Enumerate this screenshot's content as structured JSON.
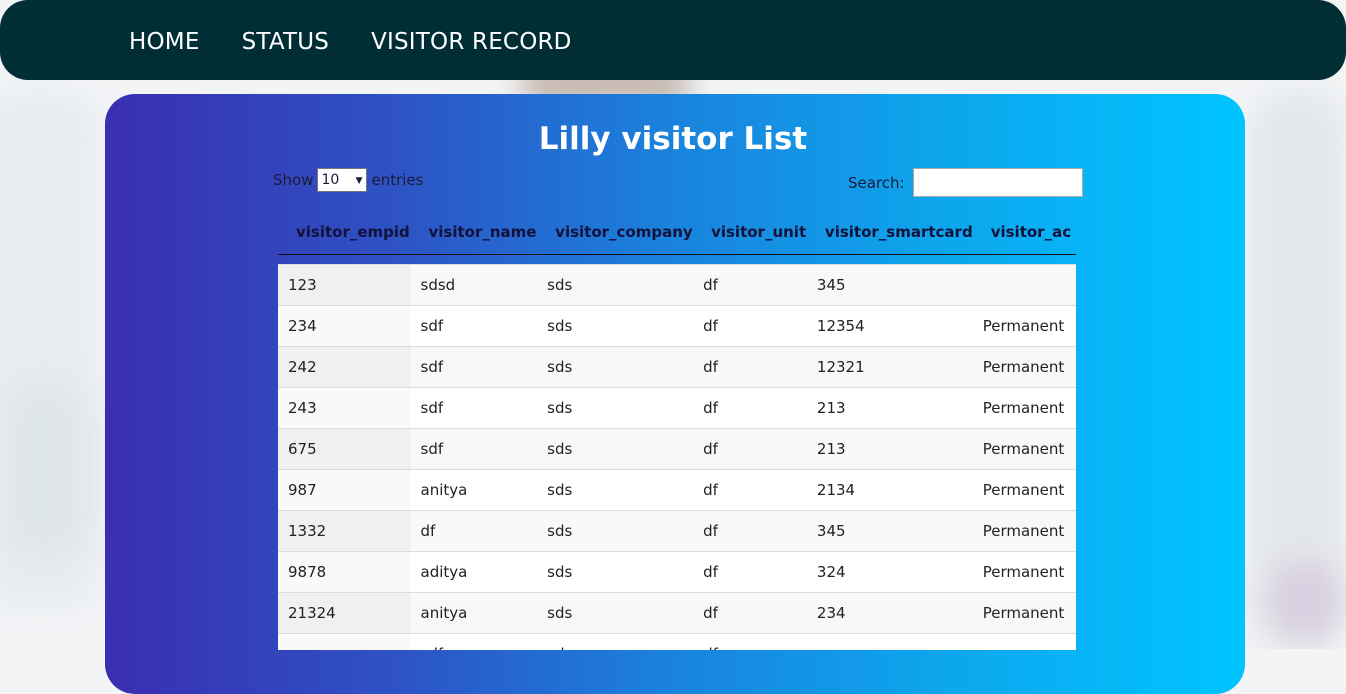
{
  "nav": {
    "items": [
      "HOME",
      "STATUS",
      "VISITOR RECORD"
    ]
  },
  "title": "Lilly visitor List",
  "length_control": {
    "show_label": "Show",
    "selected": "10",
    "entries_label": "entries"
  },
  "search": {
    "label": "Search:",
    "value": ""
  },
  "table": {
    "columns": [
      "visitor_empid",
      "visitor_name",
      "visitor_company",
      "visitor_unit",
      "visitor_smartcard",
      "visitor_ac"
    ],
    "rows": [
      [
        "123",
        "sdsd",
        "sds",
        "df",
        "345",
        ""
      ],
      [
        "234",
        "sdf",
        "sds",
        "df",
        "12354",
        "Permanent"
      ],
      [
        "242",
        "sdf",
        "sds",
        "df",
        "12321",
        "Permanent"
      ],
      [
        "243",
        "sdf",
        "sds",
        "df",
        "213",
        "Permanent"
      ],
      [
        "675",
        "sdf",
        "sds",
        "df",
        "213",
        "Permanent"
      ],
      [
        "987",
        "anitya",
        "sds",
        "df",
        "2134",
        "Permanent"
      ],
      [
        "1332",
        "df",
        "sds",
        "df",
        "345",
        "Permanent"
      ],
      [
        "9878",
        "aditya",
        "sds",
        "df",
        "324",
        "Permanent"
      ],
      [
        "21324",
        "anitya",
        "sds",
        "df",
        "234",
        "Permanent"
      ],
      [
        "",
        "sdf",
        "sds",
        "df",
        "",
        ""
      ]
    ]
  },
  "colors": {
    "navbar": "#012e34",
    "gradient_start": "#3a2eb2",
    "gradient_end": "#00c4fe"
  }
}
